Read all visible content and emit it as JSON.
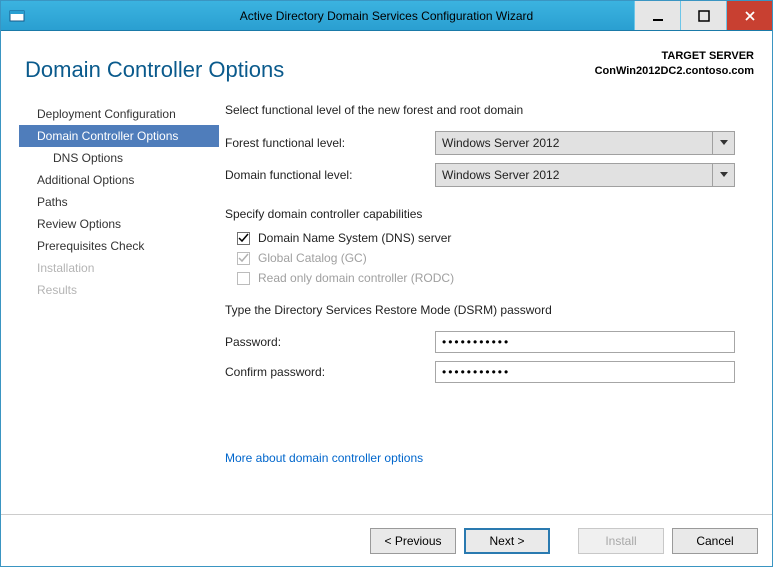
{
  "window": {
    "title": "Active Directory Domain Services Configuration Wizard"
  },
  "header": {
    "page_title": "Domain Controller Options",
    "target_label": "TARGET SERVER",
    "target_value": "ConWin2012DC2.contoso.com"
  },
  "sidebar": {
    "items": [
      {
        "label": "Deployment Configuration",
        "selected": false,
        "disabled": false,
        "indent": false
      },
      {
        "label": "Domain Controller Options",
        "selected": true,
        "disabled": false,
        "indent": false
      },
      {
        "label": "DNS Options",
        "selected": false,
        "disabled": false,
        "indent": true
      },
      {
        "label": "Additional Options",
        "selected": false,
        "disabled": false,
        "indent": false
      },
      {
        "label": "Paths",
        "selected": false,
        "disabled": false,
        "indent": false
      },
      {
        "label": "Review Options",
        "selected": false,
        "disabled": false,
        "indent": false
      },
      {
        "label": "Prerequisites Check",
        "selected": false,
        "disabled": false,
        "indent": false
      },
      {
        "label": "Installation",
        "selected": false,
        "disabled": true,
        "indent": false
      },
      {
        "label": "Results",
        "selected": false,
        "disabled": true,
        "indent": false
      }
    ]
  },
  "main": {
    "functional_intro": "Select functional level of the new forest and root domain",
    "forest_label": "Forest functional level:",
    "forest_value": "Windows Server 2012",
    "domain_label": "Domain functional level:",
    "domain_value": "Windows Server 2012",
    "capabilities_label": "Specify domain controller capabilities",
    "cap_dns": {
      "label": "Domain Name System (DNS) server",
      "checked": true,
      "disabled": false
    },
    "cap_gc": {
      "label": "Global Catalog (GC)",
      "checked": true,
      "disabled": true
    },
    "cap_rodc": {
      "label": "Read only domain controller (RODC)",
      "checked": false,
      "disabled": true
    },
    "dsrm_label": "Type the Directory Services Restore Mode (DSRM) password",
    "password_label": "Password:",
    "password_value": "•••••••••••",
    "confirm_label": "Confirm password:",
    "confirm_value": "•••••••••••",
    "help_link": "More about domain controller options"
  },
  "footer": {
    "previous": "< Previous",
    "next": "Next >",
    "install": "Install",
    "cancel": "Cancel"
  }
}
